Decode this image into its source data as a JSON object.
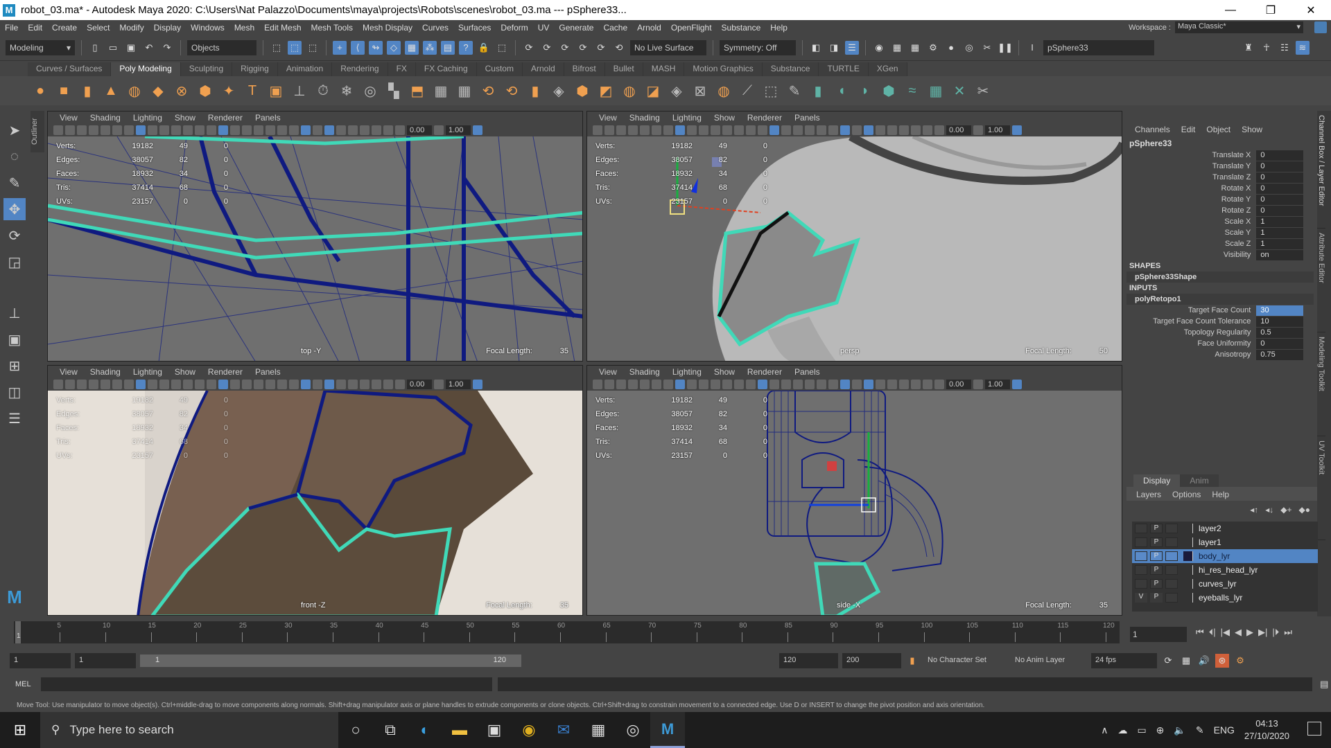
{
  "window": {
    "title": "robot_03.ma* - Autodesk Maya 2020: C:\\Users\\Nat Palazzo\\Documents\\maya\\projects\\Robots\\scenes\\robot_03.ma   ---   pSphere33...",
    "logo": "M",
    "minimize": "—",
    "maximize": "❐",
    "close": "✕"
  },
  "menu": [
    "File",
    "Edit",
    "Create",
    "Select",
    "Modify",
    "Display",
    "Windows",
    "Mesh",
    "Edit Mesh",
    "Mesh Tools",
    "Mesh Display",
    "Curves",
    "Surfaces",
    "Deform",
    "UV",
    "Generate",
    "Cache",
    "Arnold",
    "OpenFlight",
    "Substance",
    "Help"
  ],
  "workspace": {
    "label": "Workspace :",
    "value": "Maya Classic*"
  },
  "statusline": {
    "menuset": "Modeling",
    "selmode": "Objects",
    "live_surface": "No Live Surface",
    "symmetry": "Symmetry: Off",
    "name_field": "pSphere33"
  },
  "shelf_tabs": [
    "Curves / Surfaces",
    "Poly Modeling",
    "Sculpting",
    "Rigging",
    "Animation",
    "Rendering",
    "FX",
    "FX Caching",
    "Custom",
    "Arnold",
    "Bifrost",
    "Bullet",
    "MASH",
    "Motion Graphics",
    "Substance",
    "TURTLE",
    "XGen"
  ],
  "shelf_active_tab": "Poly Modeling",
  "viewport_menu": [
    "View",
    "Shading",
    "Lighting",
    "Show",
    "Renderer",
    "Panels"
  ],
  "viewport_fields": {
    "exposure": "0.00",
    "gamma": "1.00"
  },
  "hud": {
    "rows": [
      {
        "label": "Verts:",
        "v1": "19182",
        "v2": "49",
        "v3": "0"
      },
      {
        "label": "Edges:",
        "v1": "38057",
        "v2": "82",
        "v3": "0"
      },
      {
        "label": "Faces:",
        "v1": "18932",
        "v2": "34",
        "v3": "0"
      },
      {
        "label": "Tris:",
        "v1": "37414",
        "v2": "68",
        "v3": "0"
      },
      {
        "label": "UVs:",
        "v1": "23157",
        "v2": "0",
        "v3": "0"
      }
    ],
    "focal_label": "Focal Length:"
  },
  "viewports": [
    {
      "camera": "top -Y",
      "focal": "35"
    },
    {
      "camera": "persp",
      "focal": "50"
    },
    {
      "camera": "front -Z",
      "focal": "35"
    },
    {
      "camera": "side -X",
      "focal": "35"
    }
  ],
  "outliner_tab": "Outliner",
  "channel_box": {
    "menu": [
      "Channels",
      "Edit",
      "Object",
      "Show"
    ],
    "object": "pSphere33",
    "attributes": [
      {
        "name": "Translate X",
        "value": "0"
      },
      {
        "name": "Translate Y",
        "value": "0"
      },
      {
        "name": "Translate Z",
        "value": "0"
      },
      {
        "name": "Rotate X",
        "value": "0"
      },
      {
        "name": "Rotate Y",
        "value": "0"
      },
      {
        "name": "Rotate Z",
        "value": "0"
      },
      {
        "name": "Scale X",
        "value": "1"
      },
      {
        "name": "Scale Y",
        "value": "1"
      },
      {
        "name": "Scale Z",
        "value": "1"
      },
      {
        "name": "Visibility",
        "value": "on"
      }
    ],
    "shapes_label": "SHAPES",
    "shape": "pSphere33Shape",
    "inputs_label": "INPUTS",
    "input_node": "polyRetopo1",
    "input_attributes": [
      {
        "name": "Target Face Count",
        "value": "30"
      },
      {
        "name": "Target Face Count Tolerance",
        "value": "10"
      },
      {
        "name": "Topology Regularity",
        "value": "0.5"
      },
      {
        "name": "Face Uniformity",
        "value": "0"
      },
      {
        "name": "Anisotropy",
        "value": "0.75"
      }
    ]
  },
  "side_tabs": [
    "Channel Box / Layer Editor",
    "Attribute Editor",
    "Modeling Toolkit",
    "UV Toolkit"
  ],
  "layer_editor": {
    "tabs": [
      "Display",
      "Anim"
    ],
    "menu": [
      "Layers",
      "Options",
      "Help"
    ],
    "layers": [
      {
        "name": "layer2",
        "v": "",
        "p": "P",
        "selected": false
      },
      {
        "name": "layer1",
        "v": "",
        "p": "P",
        "selected": false
      },
      {
        "name": "body_lyr",
        "v": "",
        "p": "P",
        "selected": true
      },
      {
        "name": "hi_res_head_lyr",
        "v": "",
        "p": "P",
        "selected": false
      },
      {
        "name": "curves_lyr",
        "v": "",
        "p": "P",
        "selected": false
      },
      {
        "name": "eyeballs_lyr",
        "v": "V",
        "p": "P",
        "selected": false
      }
    ]
  },
  "timeline": {
    "ticks": [
      "5",
      "10",
      "15",
      "20",
      "25",
      "30",
      "35",
      "40",
      "45",
      "50",
      "55",
      "60",
      "65",
      "70",
      "75",
      "80",
      "85",
      "90",
      "95",
      "100",
      "105",
      "110",
      "115",
      "120"
    ],
    "start_label": "1",
    "current_frame": "1"
  },
  "range": {
    "start": "1",
    "anim_start": "1",
    "range_start": "1",
    "range_end": "120",
    "end": "120",
    "anim_end": "200",
    "character_set": "No Character Set",
    "anim_layer": "No Anim Layer",
    "fps": "24 fps"
  },
  "mel": {
    "label": "MEL"
  },
  "help_line": "Move Tool: Use manipulator to move object(s). Ctrl+middle-drag to move components along normals. Shift+drag manipulator axis or plane handles to extrude components or clone objects. Ctrl+Shift+drag to constrain movement to a connected edge. Use D or INSERT to change the pivot position and axis orientation.",
  "taskbar": {
    "search_placeholder": "Type here to search",
    "tray_lang": "ENG",
    "time": "04:13",
    "date": "27/10/2020"
  }
}
